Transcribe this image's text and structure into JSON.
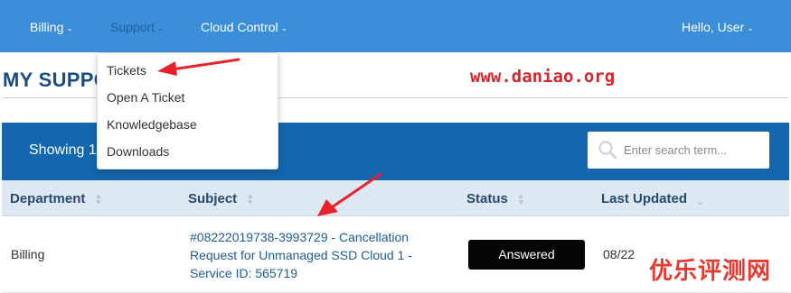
{
  "nav": {
    "billing": "Billing",
    "support": "Support",
    "cloud_control": "Cloud Control",
    "user": "Hello, User"
  },
  "page": {
    "title": "MY SUPPO",
    "watermark": "www.daniao.org",
    "corner_mark": "优乐评测网"
  },
  "dropdown": {
    "items": [
      "Tickets",
      "Open A Ticket",
      "Knowledgebase",
      "Downloads"
    ]
  },
  "panel": {
    "showing": "Showing 1",
    "search_placeholder": "Enter search term..."
  },
  "table": {
    "headers": [
      "Department",
      "Subject",
      "Status",
      "Last Updated"
    ],
    "rows": [
      {
        "department": "Billing",
        "subject": "#08222019738-3993729 - Cancellation Request for Unmanaged SSD Cloud 1 - Service ID: 565719",
        "status": "Answered",
        "last_updated": "08/22"
      }
    ]
  },
  "colors": {
    "navbar": "#3b8fd8",
    "panel_header": "#1466ad",
    "annotation_arrow": "#e8222a",
    "status_badge": "#050505"
  }
}
